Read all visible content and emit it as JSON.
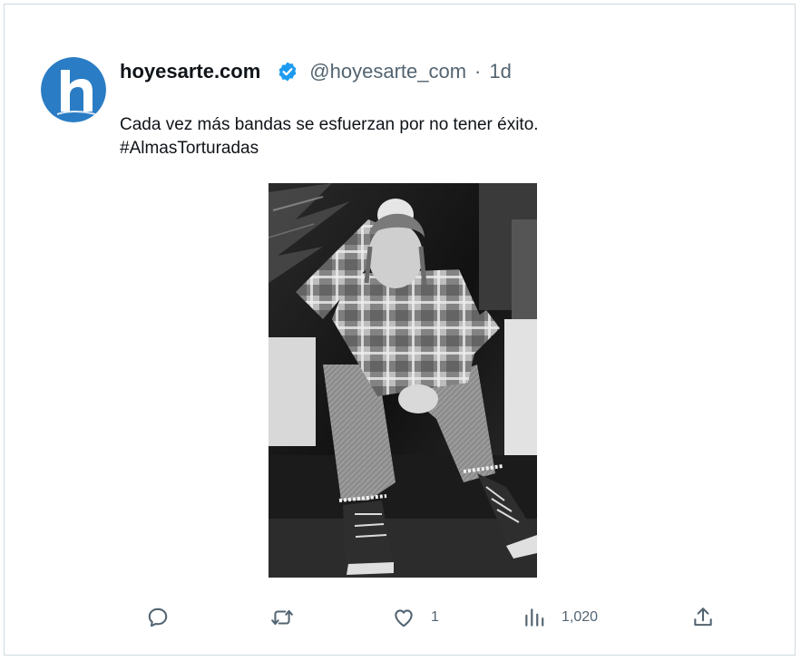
{
  "tweet": {
    "display_name": "hoyesarte.com",
    "handle": "@hoyesarte_com",
    "separator": "·",
    "time": "1d",
    "text_line1": "Cada vez más bandas se esfuerzan por no tener éxito.",
    "text_line2": "#AlmasTorturadas",
    "avatar_letter": "h",
    "media_alt": "Black and white photo of a man in a plaid flannel shirt and jeans sitting on a step, hand on his head"
  },
  "actions": {
    "reply_count": "",
    "retweet_count": "",
    "like_count": "1",
    "views_count": "1,020"
  },
  "colors": {
    "brand_blue": "#2a7cc4",
    "verified_blue": "#1d9bf0",
    "text_primary": "#0f1419",
    "text_secondary": "#536471",
    "border": "#cfd9de"
  },
  "icons": {
    "reply": "reply-icon",
    "retweet": "retweet-icon",
    "like": "heart-icon",
    "views": "views-icon",
    "share": "share-icon",
    "verified": "verified-badge-icon"
  }
}
